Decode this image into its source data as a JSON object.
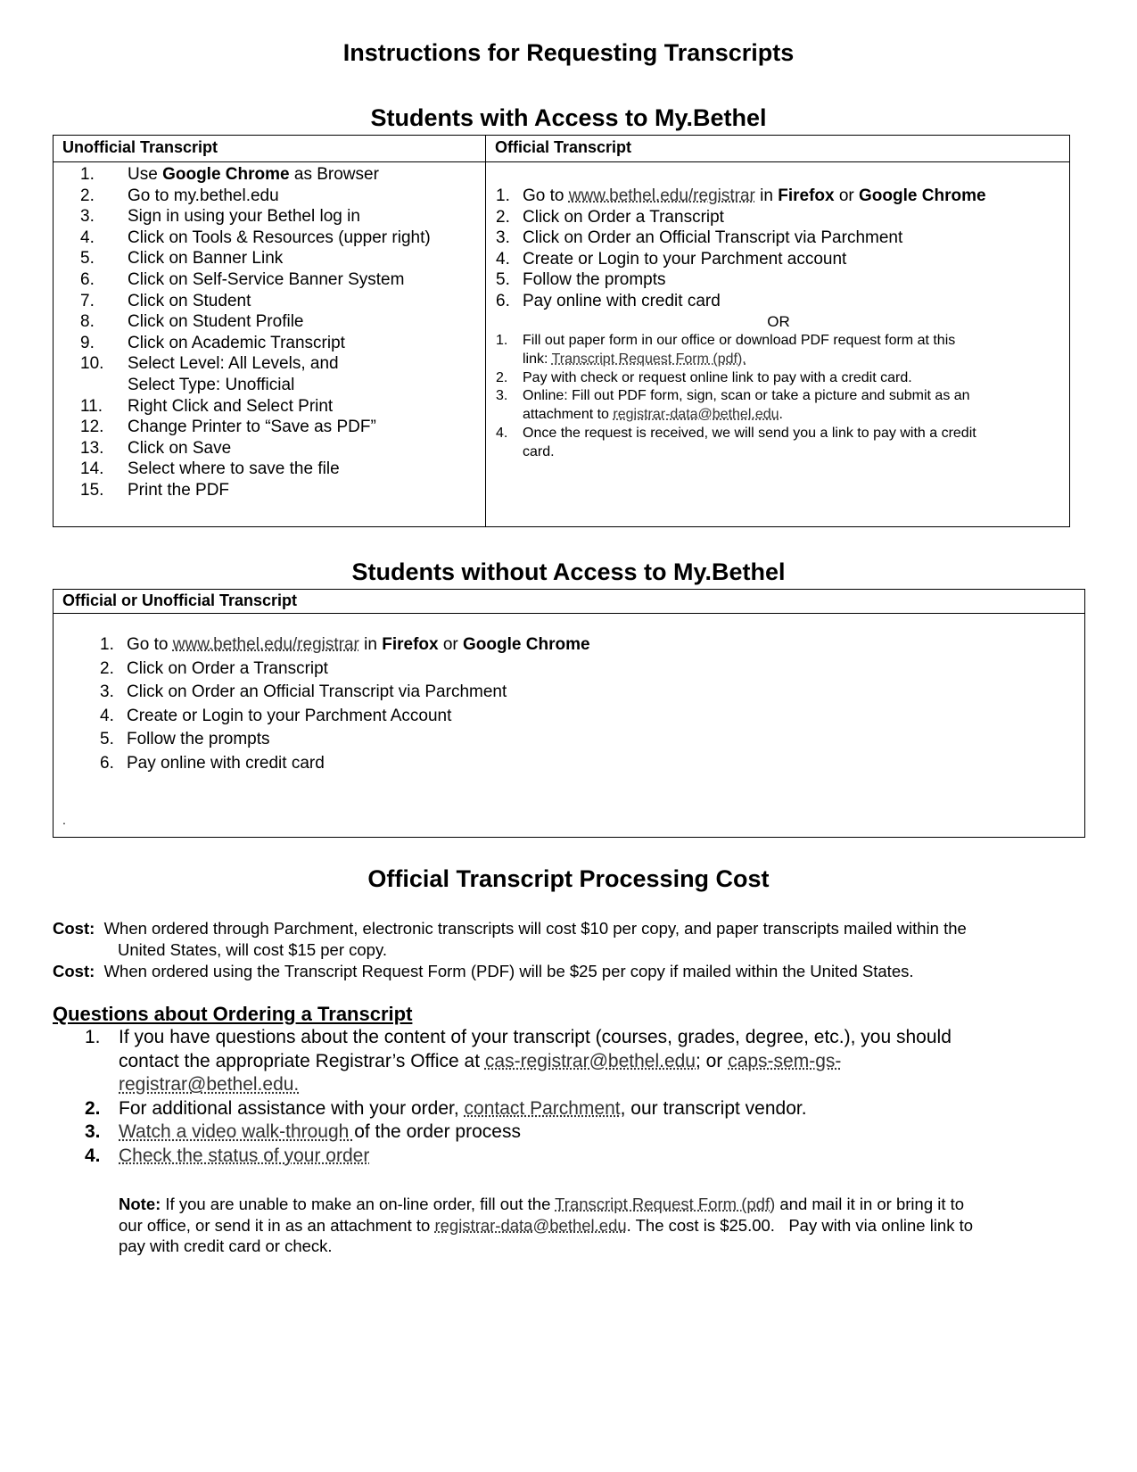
{
  "title": "Instructions for Requesting Transcripts",
  "with_access": {
    "heading": "Students with Access to My.Bethel",
    "unofficial": {
      "header": "Unofficial Transcript",
      "steps": [
        {
          "n": "1.",
          "pre": "Use ",
          "bold": "Google Chrome",
          "post": " as Browser"
        },
        {
          "n": "2.",
          "text": "Go to my.bethel.edu"
        },
        {
          "n": "3.",
          "text": "Sign in using your Bethel log in"
        },
        {
          "n": "4.",
          "text": "Click on Tools & Resources (upper right)"
        },
        {
          "n": "5.",
          "text": "Click on Banner Link"
        },
        {
          "n": "6.",
          "text": "Click on Self-Service Banner System"
        },
        {
          "n": "7.",
          "text": "Click on Student"
        },
        {
          "n": "8.",
          "text": "Click on Student Profile"
        },
        {
          "n": "9.",
          "text": "Click on Academic Transcript"
        },
        {
          "n": "10.",
          "text": "Select Level: All Levels, and",
          "text2": "Select Type: Unofficial"
        },
        {
          "n": "11.",
          "text": "Right Click and Select Print"
        },
        {
          "n": "12.",
          "text": "Change Printer to “Save as PDF”"
        },
        {
          "n": "13.",
          "text": "Click on Save"
        },
        {
          "n": "14.",
          "text": "Select where to save the file"
        },
        {
          "n": "15.",
          "text": "Print the PDF"
        }
      ]
    },
    "official": {
      "header": "Official Transcript",
      "step1": {
        "n": "1.",
        "pre": "Go to ",
        "link": "www.bethel.edu/registrar",
        "mid": " in ",
        "b1": "Firefox",
        "or": " or ",
        "b2": "Google Chrome"
      },
      "steps": [
        {
          "n": "2.",
          "text": "Click on Order a Transcript"
        },
        {
          "n": "3.",
          "text": "Click on Order an Official Transcript via Parchment"
        },
        {
          "n": "4.",
          "text": "Create or Login to your Parchment account"
        },
        {
          "n": "5.",
          "text": "Follow the prompts"
        },
        {
          "n": "6.",
          "text": "Pay online with credit card"
        }
      ],
      "or_label": "OR",
      "alt_steps": {
        "s1": {
          "n": "1.",
          "text": "Fill out paper form in our office or download PDF request form at this",
          "pre2": "link: ",
          "link": "Transcript Request Form (pdf)."
        },
        "s2": {
          "n": "2.",
          "text": "Pay with check or request online link to pay with a credit card."
        },
        "s3": {
          "n": "3.",
          "text": "Online: Fill out PDF form, sign, scan or take a picture and submit as an",
          "pre2": "attachment to ",
          "link": "registrar-data@bethel.edu",
          "post2": "."
        },
        "s4": {
          "n": "4.",
          "text": "Once the request is received, we will send you a link to pay with a credit",
          "text2": "card."
        }
      }
    }
  },
  "without_access": {
    "heading": "Students without Access to My.Bethel",
    "header": "Official or Unofficial Transcript",
    "step1": {
      "n": "1.",
      "pre": "Go to ",
      "link": "www.bethel.edu/registrar",
      "mid": " in ",
      "b1": "Firefox",
      "or": " or ",
      "b2": "Google Chrome"
    },
    "steps": [
      {
        "n": "2.",
        "text": "Click on Order a Transcript"
      },
      {
        "n": "3.",
        "text": "Click on Order an Official Transcript via Parchment"
      },
      {
        "n": "4.",
        "text": "Create or Login to your Parchment Account"
      },
      {
        "n": "5.",
        "text": "Follow the prompts"
      },
      {
        "n": "6.",
        "text": "Pay online with credit card"
      }
    ],
    "dot": "."
  },
  "cost": {
    "heading": "Official Transcript Processing Cost",
    "label": "Cost:",
    "line1a": "When ordered through Parchment, electronic transcripts will cost $10 per copy, and paper transcripts mailed within the",
    "line1b": "United States, will cost $15 per copy.",
    "line2": "When ordered using the Transcript Request Form (PDF) will be $25 per copy if mailed within the United States."
  },
  "questions": {
    "heading": "Questions about Ordering a Transcript",
    "q1": {
      "n": "1.",
      "l1": "If you have questions about the content of your transcript (courses, grades, degree, etc.), you should",
      "l2pre": "contact the appropriate Registrar’s Office at ",
      "link1": "cas-registrar@bethel.edu",
      "sep": "; or ",
      "link2a": "caps-sem-gs-",
      "link2b": "registrar@bethel.edu."
    },
    "q2": {
      "n": "2.",
      "pre": "For additional assistance with your order, ",
      "link": "contact Parchment",
      "post": ", our transcript vendor."
    },
    "q3": {
      "n": "3.",
      "link": "Watch a video walk-through ",
      "post": "of the order process"
    },
    "q4": {
      "n": "4.",
      "link": "Check the status of your order"
    },
    "note": {
      "label": "Note:",
      "l1pre": " If you are unable to make an on-line order, fill out the ",
      "link1": "Transcript Request Form (pdf)",
      "l1post": " and mail it in or bring it to",
      "l2pre": "our office, or send it in as an attachment to ",
      "link2": "registrar-data@bethel.edu",
      "l2post": ". The cost is $25.00.   Pay with via online link to",
      "l3": "pay with credit card or check."
    }
  }
}
